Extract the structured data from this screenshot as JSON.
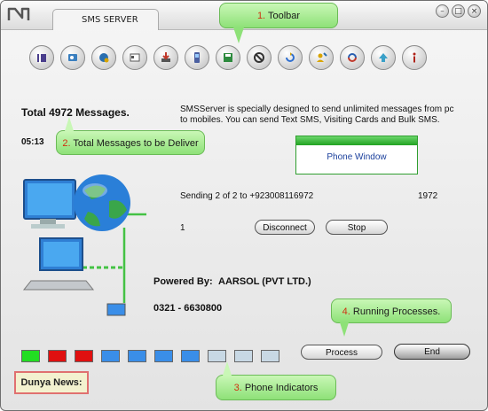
{
  "window": {
    "title": "SMS SERVER",
    "controls": [
      "–",
      "□",
      "×"
    ]
  },
  "toolbar": {
    "buttons": [
      {
        "name": "book-icon",
        "color": "#4a3e8c"
      },
      {
        "name": "contacts-icon",
        "color": "#3a7fbf"
      },
      {
        "name": "globe-settings-icon",
        "color": "#2a6fb0"
      },
      {
        "name": "card-icon",
        "color": "#555555"
      },
      {
        "name": "import-icon",
        "color": "#c0392b"
      },
      {
        "name": "phone-icon",
        "color": "#4a5fa0"
      },
      {
        "name": "save-icon",
        "color": "#2d8a3e"
      },
      {
        "name": "stop-sign-icon",
        "color": "#333333"
      },
      {
        "name": "refresh-icon",
        "color": "#2f6fd0"
      },
      {
        "name": "user-add-icon",
        "color": "#d8a400"
      },
      {
        "name": "sync-icon",
        "color": "#2a5fb0"
      },
      {
        "name": "upload-icon",
        "color": "#3aa0c8"
      },
      {
        "name": "info-icon",
        "color": "#b0241a"
      }
    ]
  },
  "callouts": {
    "toolbar": {
      "num": "1.",
      "label": "Toolbar"
    },
    "total_messages": {
      "num": "2.",
      "label": "Total Messages to be Deliver"
    },
    "phone_indicators": {
      "num": "3.",
      "label": "Phone Indicators"
    },
    "running_processes": {
      "num": "4.",
      "label": "Running Processes."
    }
  },
  "main": {
    "total": "Total 4972 Messages.",
    "time": "05:13",
    "description_line1": "SMSServer is specially designed to send unlimited messages from pc",
    "description_line2": "to mobiles. You can send Text SMS, Visiting Cards and Bulk SMS.",
    "phone_window": "Phone Window",
    "sending_status": "Sending 2 of 2 to +923008116972",
    "remaining": "1972",
    "counter": "1",
    "disconnect_label": "Disconnect",
    "stop_label": "Stop",
    "powered_by_label": "Powered By:",
    "company": "AARSOL (PVT LTD.)",
    "phone": "0321 - 6630800",
    "process_label": "Process",
    "end_label": "End"
  },
  "indicators": [
    {
      "state": "active",
      "color": "#22dd22"
    },
    {
      "state": "error",
      "color": "#e01010"
    },
    {
      "state": "error",
      "color": "#e01010"
    },
    {
      "state": "idle",
      "color": "#3a8ee8"
    },
    {
      "state": "idle",
      "color": "#3a8ee8"
    },
    {
      "state": "idle",
      "color": "#3a8ee8"
    },
    {
      "state": "idle",
      "color": "#3a8ee8"
    },
    {
      "state": "off",
      "color": "#c8d8e4"
    },
    {
      "state": "off",
      "color": "#c8d8e4"
    },
    {
      "state": "off",
      "color": "#c8d8e4"
    }
  ],
  "news": "Dunya News:"
}
